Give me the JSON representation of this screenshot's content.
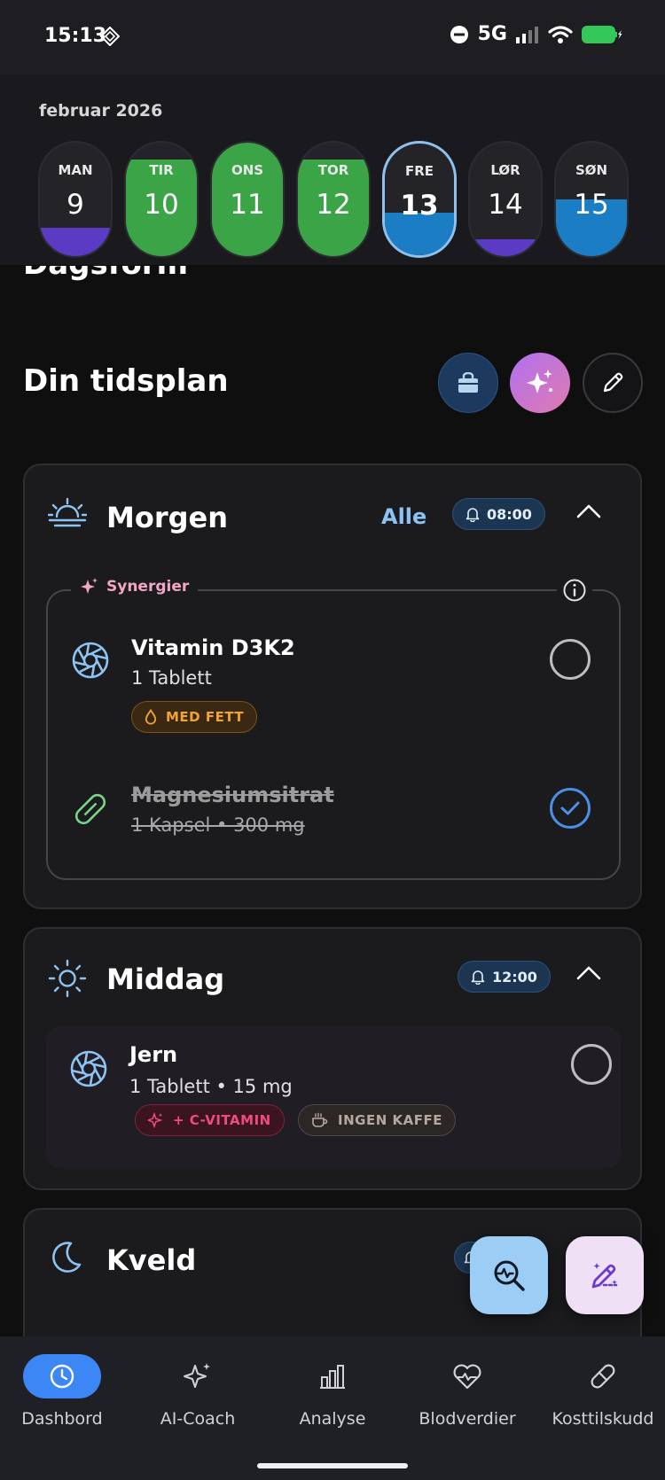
{
  "status_bar": {
    "time": "15:13",
    "network": "5G"
  },
  "calendar": {
    "month": "februar 2026",
    "days": [
      {
        "name": "MAN",
        "num": "9",
        "fill_fraction": 0.25,
        "fill_color": "#5b3bc4"
      },
      {
        "name": "TIR",
        "num": "10",
        "fill_fraction": 0.85,
        "fill_color": "#3ba447"
      },
      {
        "name": "ONS",
        "num": "11",
        "fill_fraction": 1.0,
        "fill_color": "#3ba447"
      },
      {
        "name": "TOR",
        "num": "12",
        "fill_fraction": 0.85,
        "fill_color": "#3ba447"
      },
      {
        "name": "FRE",
        "num": "13",
        "fill_fraction": 0.38,
        "fill_color": "#1b7ec4",
        "active": true
      },
      {
        "name": "LØR",
        "num": "14",
        "fill_fraction": 0.15,
        "fill_color": "#5b3bc4"
      },
      {
        "name": "SØN",
        "num": "15",
        "fill_fraction": 0.5,
        "fill_color": "#1b7ec4"
      }
    ]
  },
  "partial_heading": "Dagsform",
  "schedule": {
    "title": "Din tidsplan"
  },
  "morning": {
    "title": "Morgen",
    "all_label": "Alle",
    "time": "08:00",
    "synergy_label": "Synergier",
    "items": [
      {
        "name": "Vitamin D3K2",
        "sub": "1 Tablett",
        "tag": "MED FETT",
        "done": false
      },
      {
        "name": "Magnesiumsitrat",
        "sub": "1 Kapsel  •  300 mg",
        "done": true
      }
    ]
  },
  "midday": {
    "title": "Middag",
    "time": "12:00",
    "items": [
      {
        "name": "Jern",
        "sub": "1 Tablett  •  15 mg",
        "tags": [
          "+ C-VITAMIN",
          "INGEN KAFFE"
        ],
        "done": false
      }
    ]
  },
  "evening": {
    "title": "Kveld"
  },
  "nav": {
    "items": [
      {
        "label": "Dashbord",
        "icon": "clock-icon"
      },
      {
        "label": "AI-Coach",
        "icon": "sparkles-icon"
      },
      {
        "label": "Analyse",
        "icon": "bar-chart-icon"
      },
      {
        "label": "Blodverdier",
        "icon": "heart-pulse-icon"
      },
      {
        "label": "Kosttilskudd",
        "icon": "pill-icon"
      }
    ]
  },
  "colors": {
    "accent_blue": "#3d86f5",
    "success_green": "#3ba447",
    "purple": "#5b3bc4",
    "synergy_pink": "#f1a6c5"
  }
}
